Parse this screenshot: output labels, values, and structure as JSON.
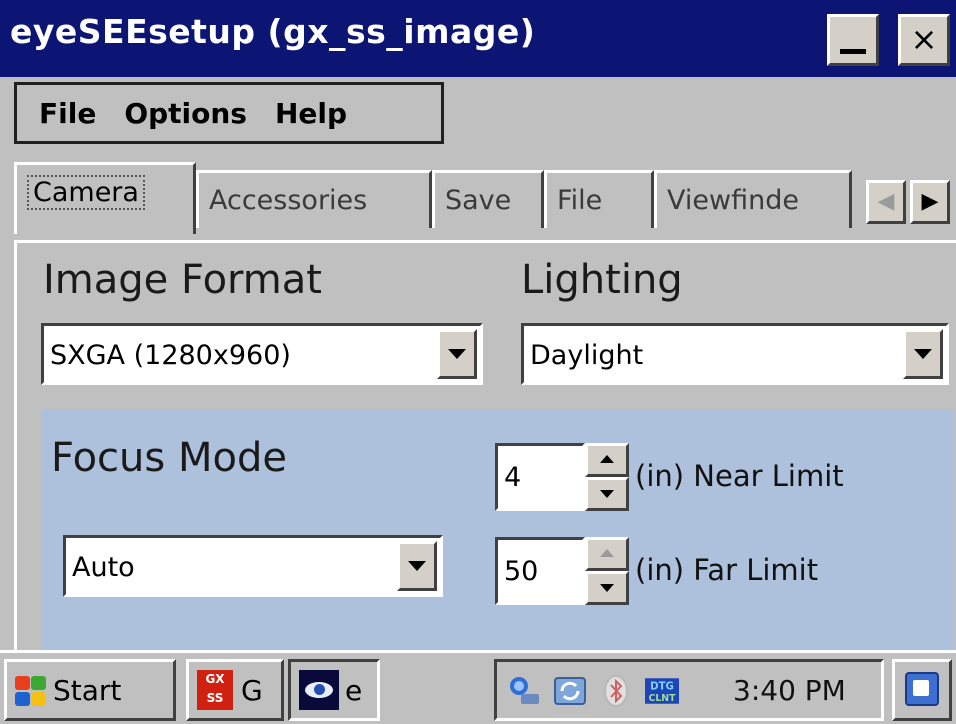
{
  "window": {
    "title": "eyeSEEsetup (gx_ss_image)",
    "minimize_glyph": "_",
    "close_glyph": "×"
  },
  "menu": {
    "items": [
      {
        "label": "File"
      },
      {
        "label": "Options"
      },
      {
        "label": "Help"
      }
    ]
  },
  "tabs": {
    "items": [
      {
        "label": "Camera",
        "active": true
      },
      {
        "label": "Accessories",
        "active": false
      },
      {
        "label": "Save",
        "active": false
      },
      {
        "label": "File",
        "active": false
      },
      {
        "label": "Viewfinde",
        "active": false
      }
    ],
    "scroll_left_glyph": "◀",
    "scroll_right_glyph": "▶"
  },
  "camera": {
    "image_format": {
      "label": "Image Format",
      "value": "SXGA (1280x960)"
    },
    "lighting": {
      "label": "Lighting",
      "value": "Daylight"
    },
    "focus": {
      "label": "Focus Mode",
      "mode_value": "Auto",
      "near_limit": {
        "value": "4",
        "label": "(in) Near Limit"
      },
      "far_limit": {
        "value": "50",
        "label": "(in) Far Limit"
      }
    }
  },
  "taskbar": {
    "start_label": "Start",
    "tasks": [
      {
        "label": "G",
        "icon": "gx-ss-app-icon",
        "icon_text": "GX SS"
      },
      {
        "label": "e",
        "icon": "eyesee-app-icon"
      }
    ],
    "clock": "3:40 PM",
    "tray_icons": [
      "network-icon",
      "sync-icon",
      "bluetooth-icon",
      "dtg-client-icon",
      "desktop-icon"
    ]
  },
  "colors": {
    "title_bar": "#0c1474",
    "focus_panel": "#adc0dc",
    "chrome": "#c0c0c0"
  }
}
